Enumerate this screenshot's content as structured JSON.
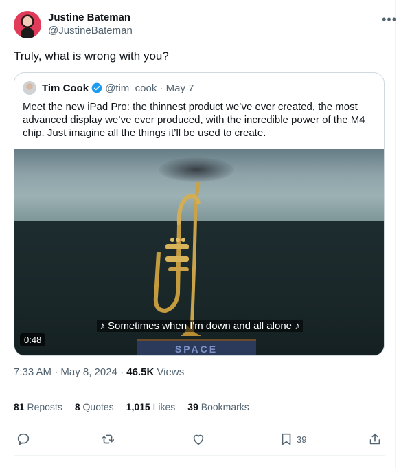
{
  "tweet": {
    "author_name": "Justine Bateman",
    "author_handle": "@JustineBateman",
    "more_icon": "more-horizontal-icon",
    "text": "Truly, what is wrong with you?"
  },
  "quote": {
    "author_name": "Tim Cook",
    "verified_icon": "verified-badge-icon",
    "handle_date": "@tim_cook · May 7",
    "text": "Meet the new iPad Pro: the thinnest product we’ve ever created, the most advanced display we’ve ever produced, with the incredible power of the M4 chip. Just imagine all the things it’ll be used to create.",
    "video": {
      "caption": "♪ Sometimes when I'm down and all alone ♪",
      "duration": "0:48",
      "sign_text": "SPACE"
    }
  },
  "meta": {
    "time_date": "7:33 AM · May 8, 2024 · ",
    "views_count": "46.5K",
    "views_label": " Views"
  },
  "stats": {
    "reposts_count": "81",
    "reposts_label": " Reposts",
    "quotes_count": "8",
    "quotes_label": " Quotes",
    "likes_count": "1,015",
    "likes_label": " Likes",
    "bookmarks_count": "39",
    "bookmarks_label": " Bookmarks"
  },
  "actions": {
    "reply_icon": "reply-icon",
    "repost_icon": "repost-icon",
    "like_icon": "like-icon",
    "bookmark_icon": "bookmark-icon",
    "bookmark_count": "39",
    "share_icon": "share-icon"
  },
  "colors": {
    "text": "#0f1419",
    "secondary": "#536471",
    "verified": "#1d9bf0",
    "border": "#cfd9de"
  }
}
